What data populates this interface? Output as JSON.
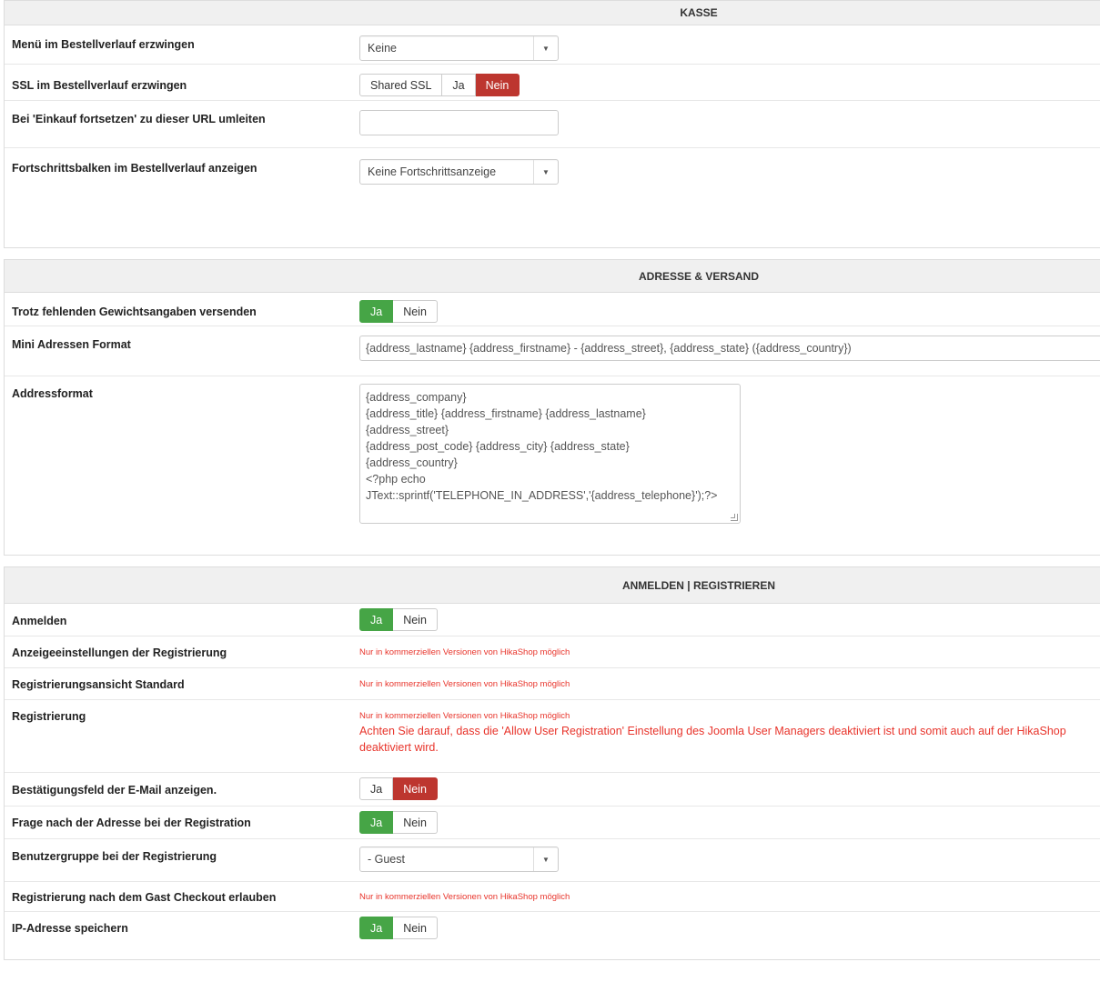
{
  "kasse": {
    "title": "KASSE",
    "menu_label": "Menü im Bestellverlauf erzwingen",
    "menu_value": "Keine",
    "ssl_label": "SSL im Bestellverlauf erzwingen",
    "ssl_options": [
      "Shared SSL",
      "Ja",
      "Nein"
    ],
    "ssl_selected": "Nein",
    "redirect_label": "Bei 'Einkauf fortsetzen' zu dieser URL umleiten",
    "redirect_value": "",
    "progress_label": "Fortschrittsbalken im Bestellverlauf anzeigen",
    "progress_value": "Keine Fortschrittsanzeige"
  },
  "adresse": {
    "title": "ADRESSE & VERSAND",
    "weight_label": "Trotz fehlenden Gewichtsangaben versenden",
    "weight_yes": "Ja",
    "weight_no": "Nein",
    "weight_selected": "Ja",
    "mini_label": "Mini Adressen Format",
    "mini_value": "{address_lastname} {address_firstname} - {address_street}, {address_state} ({address_country})",
    "format_label": "Addressformat",
    "format_lines": [
      "{address_company}",
      "{address_title} {address_firstname} {address_lastname}",
      "{address_street}",
      "{address_post_code} {address_city} {address_state}",
      "{address_country}",
      "<?php echo",
      "JText::sprintf('TELEPHONE_IN_ADDRESS','{address_telephone}');?>"
    ]
  },
  "anmelden": {
    "title": "ANMELDEN | REGISTRIEREN",
    "login_label": "Anmelden",
    "login_yes": "Ja",
    "login_no": "Nein",
    "login_selected": "Ja",
    "display_label": "Anzeigeeinstellungen der Registrierung",
    "display_note": "Nur in kommerziellen Versionen von HikaShop möglich",
    "default_label": "Registrierungsansicht Standard",
    "default_note": "Nur in kommerziellen Versionen von HikaShop möglich",
    "reg_label": "Registrierung",
    "reg_note": "Nur in kommerziellen Versionen von HikaShop möglich",
    "reg_warning": "Achten Sie darauf, dass die 'Allow User Registration' Einstellung des Joomla User Managers deaktiviert ist und somit auch auf der HikaShop deaktiviert wird.",
    "email_label": "Bestätigungsfeld der E-Mail anzeigen.",
    "email_yes": "Ja",
    "email_no": "Nein",
    "email_selected": "Nein",
    "address_label": "Frage nach der Adresse bei der Registration",
    "address_yes": "Ja",
    "address_no": "Nein",
    "address_selected": "Ja",
    "group_label": "Benutzergruppe bei der Registrierung",
    "group_value": "- Guest",
    "guest_label": "Registrierung nach dem Gast Checkout erlauben",
    "guest_note": "Nur in kommerziellen Versionen von HikaShop möglich",
    "ip_label": "IP-Adresse speichern",
    "ip_yes": "Ja",
    "ip_no": "Nein",
    "ip_selected": "Ja"
  },
  "icons": {
    "dropdown": "caret-down-icon",
    "resize": "resize-handle-icon"
  },
  "colors": {
    "green": "#46a546",
    "red": "#bd362f",
    "note": "#e8342b"
  }
}
